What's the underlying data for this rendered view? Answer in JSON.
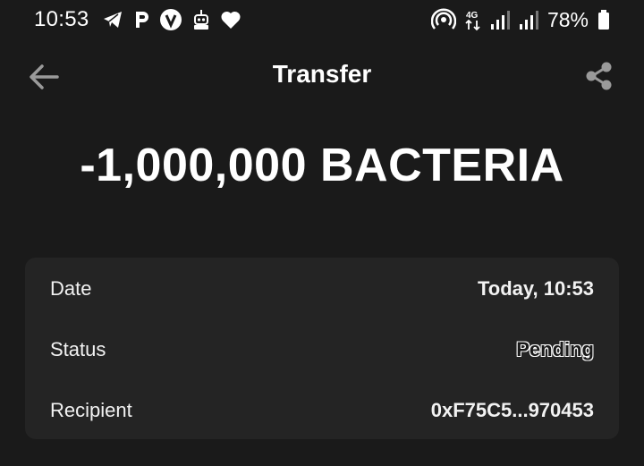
{
  "status_bar": {
    "time": "10:53",
    "battery": "78%",
    "network": "4G",
    "left_icons": [
      "telegram-icon",
      "p-app-icon",
      "verified-v-icon",
      "robot-icon",
      "heart-icon"
    ],
    "right_icons": [
      "hotspot-icon",
      "4g-data-icon",
      "signal-icon",
      "signal-icon",
      "battery-icon"
    ]
  },
  "app_bar": {
    "title": "Transfer",
    "back_icon": "arrow-left-icon",
    "share_icon": "share-icon"
  },
  "transfer": {
    "amount": "-1,000,000 BACTERIA"
  },
  "details": [
    {
      "label": "Date",
      "value": "Today, 10:53"
    },
    {
      "label": "Status",
      "value": "Pending"
    },
    {
      "label": "Recipient",
      "value": "0xF75C5...970453"
    }
  ],
  "colors": {
    "background": "#1a1a1a",
    "card": "#242424",
    "text": "#ffffff",
    "icon_muted": "#9a9a9a"
  }
}
